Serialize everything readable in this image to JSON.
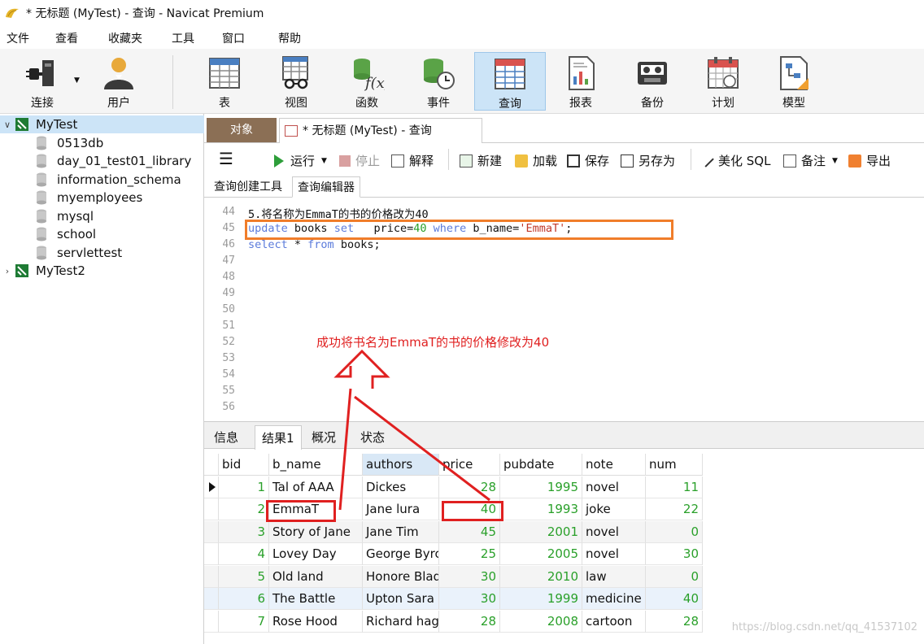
{
  "window": {
    "title": "* 无标题 (MyTest) - 查询 - Navicat Premium"
  },
  "menu": [
    "文件",
    "查看",
    "收藏夹",
    "工具",
    "窗口",
    "帮助"
  ],
  "toolbar": {
    "connect": "连接",
    "user": "用户",
    "table": "表",
    "view": "视图",
    "function": "函数",
    "event": "事件",
    "query": "查询",
    "report": "报表",
    "backup": "备份",
    "schedule": "计划",
    "model": "模型"
  },
  "sidebar": {
    "connections": [
      {
        "name": "MyTest",
        "expanded": true,
        "databases": [
          "0513db",
          "day_01_test01_library",
          "information_schema",
          "myemployees",
          "mysql",
          "school",
          "servlettest"
        ]
      },
      {
        "name": "MyTest2",
        "expanded": false
      }
    ]
  },
  "tabs": {
    "objects": "对象",
    "query_tab": "* 无标题 (MyTest) - 查询"
  },
  "query_toolbar": {
    "run": "运行",
    "stop": "停止",
    "explain": "解释",
    "new": "新建",
    "load": "加载",
    "save": "保存",
    "save_as": "另存为",
    "beautify": "美化 SQL",
    "comment": "备注",
    "export": "导出"
  },
  "subtabs": {
    "builder": "查询创建工具",
    "editor": "查询编辑器"
  },
  "editor": {
    "line_numbers": [
      "44",
      "45",
      "46",
      "47",
      "48",
      "49",
      "50",
      "51",
      "52",
      "53",
      "54",
      "55",
      "56"
    ],
    "line44": "5.将名称为EmmaT的书的价格改为40",
    "line45": {
      "kw1": "update",
      "t1": " books ",
      "kw2": "set",
      "t2": "   price=",
      "n1": "40",
      "t3": " ",
      "kw3": "where",
      "t4": " b_name=",
      "s1": "'EmmaT'",
      "t5": ";"
    },
    "line46": {
      "kw1": "select",
      "t1": " * ",
      "kw2": "from",
      "t2": " books;"
    },
    "annotation": "成功将书名为EmmaT的书的价格修改为40"
  },
  "result_tabs": [
    "信息",
    "结果1",
    "概况",
    "状态"
  ],
  "grid": {
    "columns": [
      "bid",
      "b_name",
      "authors",
      "price",
      "pubdate",
      "note",
      "num"
    ],
    "rows": [
      [
        "1",
        "Tal of AAA",
        "Dickes",
        "28",
        "1995",
        "novel",
        "11"
      ],
      [
        "2",
        "EmmaT",
        "Jane lura",
        "40",
        "1993",
        "joke",
        "22"
      ],
      [
        "3",
        "Story of Jane",
        "Jane Tim",
        "45",
        "2001",
        "novel",
        "0"
      ],
      [
        "4",
        "Lovey Day",
        "George Byrc",
        "25",
        "2005",
        "novel",
        "30"
      ],
      [
        "5",
        "Old land",
        "Honore Blad",
        "30",
        "2010",
        "law",
        "0"
      ],
      [
        "6",
        "The Battle",
        "Upton Sara",
        "30",
        "1999",
        "medicine",
        "40"
      ],
      [
        "7",
        "Rose Hood",
        "Richard hag",
        "28",
        "2008",
        "cartoon",
        "28"
      ]
    ]
  },
  "watermark": "https://blog.csdn.net/qq_41537102",
  "colors": {
    "accent_orange": "#f07d2a",
    "annotation_red": "#e02020",
    "selection_blue": "#cce4f7"
  }
}
